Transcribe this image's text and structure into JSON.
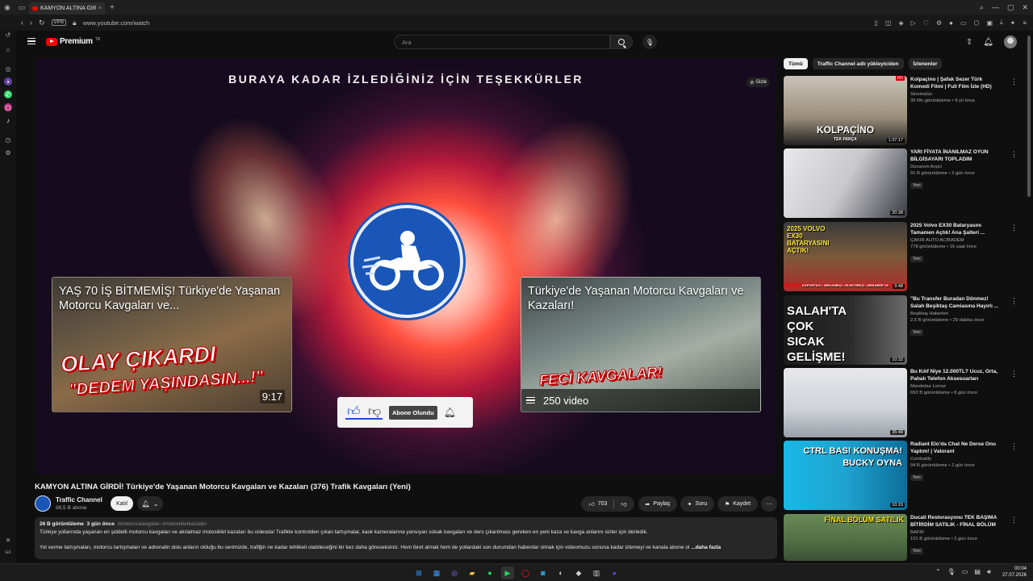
{
  "browser": {
    "tab_title": "KAMYON ALTINA GİRDİ Tü",
    "vpn_label": "VPN",
    "url": "www.youtube.com/watch"
  },
  "header": {
    "brand": "Premium",
    "country_code": "TR",
    "search_placeholder": "Ara"
  },
  "video": {
    "thanks_text": "BURAYA KADAR İZLEDİĞİNİZ İÇİN TEŞEKKÜRLER",
    "hide_label": "Gizle",
    "endcard_left": {
      "title": "YAŞ 70 İŞ BİTMEMİŞ! Türkiye'de Yaşanan Motorcu Kavgaları ve...",
      "overlay_1": "OLAY ÇIKARDI",
      "overlay_2": "\"DEDEM YAŞINDASIN...!\"",
      "duration": "9:17"
    },
    "endcard_right": {
      "title": "Türkiye'de Yaşanan Motorcu Kavgaları ve Kazaları!",
      "overlay_1": "FECİ KAVGALAR!",
      "playlist_count": "250 video"
    },
    "subscribed_label": "Abone Olundu"
  },
  "details": {
    "title": "KAMYON ALTINA GİRDİ! Türkiye'de Yaşanan Motorcu Kavgaları ve Kazaları (376) Trafik Kavgaları (Yeni)",
    "channel_name": "Traffic Channel",
    "subscribers": "98,5 B abone",
    "join_label": "Katıl",
    "likes": "703",
    "share_label": "Paylaş",
    "ask_label": "Soru",
    "save_label": "Kaydet"
  },
  "description": {
    "views": "26 B görüntüleme",
    "age": "3 gün önce",
    "tags": "#motorcukavgaları #motosikletkazaları",
    "line1": "Türkiye yollarında yaşanan en şiddetli motorcu kavgaları ve akılalmaz motosiklet kazaları bu videoda! Trafikte kontrolden çıkan tartışmalar, kask kameralarına yansıyan sokak kavgaları ve ders çıkarılması gereken en yeni kaza ve kavga anlarını sizler için derledik.",
    "line2": "Yol verme tartışmaları, motorcu tartışmaları ve adrenalin dolu anların olduğu bu serimizde, trafiğin ne kadar tehlikeli olabileceğini bir kez daha göreceksiniz. Hem ibret almak hem de yollardaki son durumdan haberdar olmak için videomuzu sonuna kadar izlemeyi ve kanala abone ol",
    "more_label": "...daha fazla"
  },
  "filters": {
    "chips": [
      "Tümü",
      "Traffic Channel adlı yükleyiciden",
      "İzlenenler"
    ]
  },
  "recommendations": [
    {
      "title": "Kolpaçino | Şafak Sezer Türk Komedi Filmi | Full Film İzle (HD)",
      "channel": "SinemaGo",
      "stats": "35 Mn görüntüleme • 9 yıl önce",
      "duration": "1:37:17",
      "thumb_text": "KOLPAÇİNO",
      "thumb_sub": "TEK PARÇA",
      "badge": "",
      "hd": "HD"
    },
    {
      "title": "YARI FİYATA İNANILMAZ OYUN BİLGİSAYARI TOPLADIM",
      "channel": "Donanım Arşivi",
      "stats": "91 B görüntüleme • 3 gün önce",
      "duration": "20:38",
      "thumb_text": "",
      "thumb_sub": "",
      "badge": "Yeni",
      "hd": ""
    },
    {
      "title": "2025 Volvo EX30 Bataryasını Tamamen Açtık! Ana Şalteri ...",
      "channel": "ÇAKIR AUTO ACIBADEM",
      "stats": "778 görüntüleme • 16 saat önce",
      "duration": "9:48",
      "thumb_text": "2025 VOLVO EX30 BATARYASINI AÇTIK!",
      "thumb_sub": "KAPORTACI • MEKANİKÇİ • ELEKTRİKÇİ • BERABER YA",
      "badge": "Yeni",
      "hd": ""
    },
    {
      "title": "\"Bu Transfer Buradan Dönmez! Salah Beşiktaş Camiasına Hayırlı ...",
      "channel": "Beşiktaş Haberleri",
      "stats": "2,5 B görüntüleme • 29 dakika önce",
      "duration": "10:32",
      "thumb_text": "SALAH'TA ÇOK SICAK GELİŞME!",
      "thumb_sub": "",
      "badge": "Yeni",
      "hd": ""
    },
    {
      "title": "Bu Kılıf Niye 12.000TL? Ucuz, Orta, Pahalı Telefon Aksesuarları",
      "channel": "Mendebur Lemur",
      "stats": "692 B görüntüleme • 8 gün önce",
      "duration": "35:48",
      "thumb_text": "",
      "thumb_sub": "",
      "badge": "",
      "hd": ""
    },
    {
      "title": "Radiant Elo'da Chat Ne Derse Onu Yaptım! | Valorant",
      "channel": "Combatify",
      "stats": "94 B görüntüleme • 2 gün önce",
      "duration": "10:15",
      "thumb_text": "CTRL BAS! KONUŞMA! BUCKY OYNA",
      "thumb_sub": "",
      "badge": "Yeni",
      "hd": ""
    },
    {
      "title": "Ducati Restorasyonu TEK BAŞIMA BİTİRDİM SATILIK - FİNAL BÖLÜM",
      "channel": "BAFİR",
      "stats": "101 B görüntüleme • 2 gün önce",
      "duration": "",
      "thumb_text": "FİNAL BÖLÜM SATILIK",
      "thumb_sub": "",
      "badge": "Yeni",
      "hd": ""
    }
  ],
  "taskbar": {
    "time": "00:04",
    "date": "27.07.2026"
  },
  "colors": {
    "youtube_red": "#ff0000",
    "background": "#0f0f0f",
    "center_logo_blue": "#1a56b8",
    "like_blue": "#1e4fd8"
  }
}
